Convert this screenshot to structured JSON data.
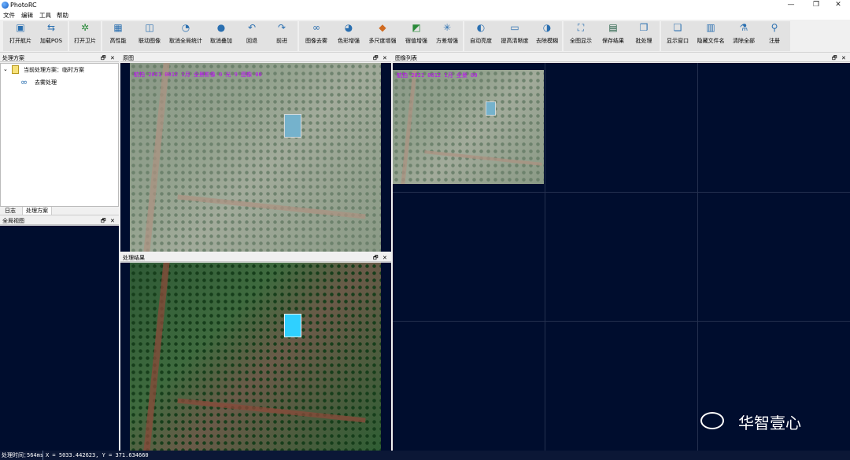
{
  "app": {
    "title": "PhotoRC"
  },
  "window_controls": {
    "minimize": "—",
    "maximize": "❐",
    "close": "✕"
  },
  "menu": [
    "文件",
    "编辑",
    "工具",
    "帮助"
  ],
  "toolbar": [
    {
      "label": "打开航片",
      "icon": "open-photo-icon"
    },
    {
      "label": "加载POS",
      "icon": "load-pos-icon"
    },
    {
      "label": "打开卫片",
      "icon": "open-satellite-icon"
    },
    {
      "label": "高性能",
      "icon": "performance-icon"
    },
    {
      "label": "联动图像",
      "icon": "link-images-icon"
    },
    {
      "label": "取消全局统计",
      "icon": "global-stats-icon"
    },
    {
      "label": "取消叠加",
      "icon": "overlay-icon"
    },
    {
      "label": "回退",
      "icon": "undo-icon"
    },
    {
      "label": "前进",
      "icon": "redo-icon"
    },
    {
      "label": "图像去雾",
      "icon": "dehaze-icon"
    },
    {
      "label": "色彩增强",
      "icon": "color-enhance-icon"
    },
    {
      "label": "多尺度增强",
      "icon": "multiscale-icon"
    },
    {
      "label": "宿值增强",
      "icon": "threshold-icon"
    },
    {
      "label": "方差增强",
      "icon": "variance-icon"
    },
    {
      "label": "自动亮度",
      "icon": "auto-brightness-icon"
    },
    {
      "label": "提高清晰度",
      "icon": "sharpen-icon"
    },
    {
      "label": "去除模糊",
      "icon": "deblur-icon"
    },
    {
      "label": "全图显示",
      "icon": "fit-view-icon"
    },
    {
      "label": "保存结果",
      "icon": "save-icon"
    },
    {
      "label": "批处理",
      "icon": "batch-icon"
    },
    {
      "label": "显示窗口",
      "icon": "show-window-icon"
    },
    {
      "label": "隐藏文件名",
      "icon": "hide-filename-icon"
    },
    {
      "label": "清除全部",
      "icon": "clear-all-icon"
    },
    {
      "label": "注册",
      "icon": "register-icon"
    }
  ],
  "panels": {
    "scheme": {
      "title": "处理方案",
      "root": "当前处理方案：临时方案",
      "child": "去雾处理"
    },
    "tabs": [
      "日志",
      "处理方案"
    ],
    "overview": {
      "title": "全局视图"
    },
    "original": {
      "title": "原图",
      "overlay": "航拍 2021 0012 1月 全景影像 0 光 9  图像 00"
    },
    "result": {
      "title": "处理结果"
    },
    "imagelist": {
      "title": "图像列表",
      "overlay": "航拍 2021 0012 1月 全景 00"
    }
  },
  "panel_controls": {
    "float": "🗗",
    "close": "✕"
  },
  "status": {
    "time_label": "处理时间：",
    "time_value": "564ms",
    "coords": "X = 5033.442623, Y = 371.634660"
  },
  "watermark": {
    "text": "华智壹心"
  },
  "colors": {
    "dark_bg": "#000d2e",
    "overlay_text": "#c000ff",
    "roof": "#3aa8e0"
  }
}
